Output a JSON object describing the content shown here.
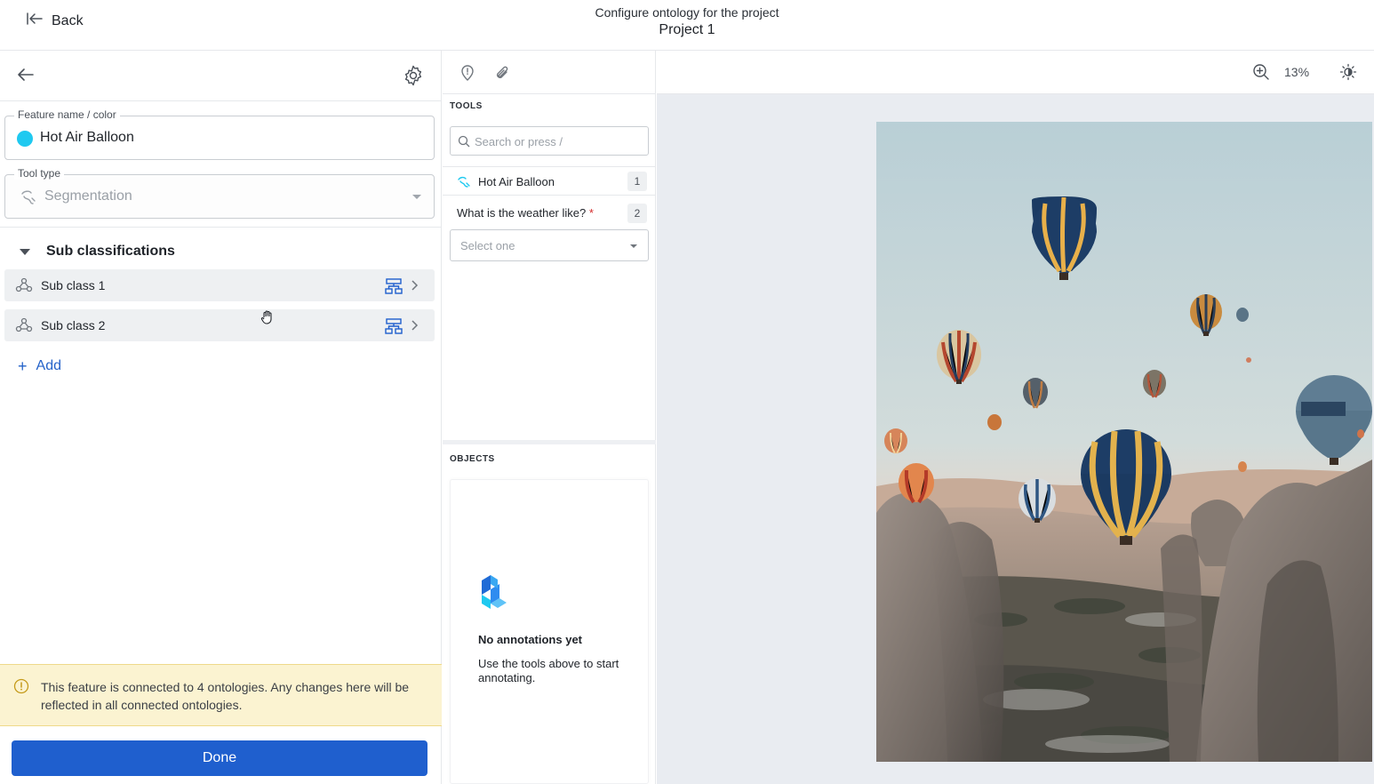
{
  "header": {
    "back_label": "Back",
    "subtitle": "Configure ontology for the project",
    "project_name": "Project 1"
  },
  "feature": {
    "name_label": "Feature name / color",
    "name_value": "Hot Air Balloon",
    "color": "#1fc9f0",
    "tool_type_label": "Tool type",
    "tool_type_value": "Segmentation"
  },
  "sub_classifications": {
    "title": "Sub classifications",
    "items": [
      {
        "label": "Sub class 1"
      },
      {
        "label": "Sub class 2"
      }
    ],
    "add_label": "Add"
  },
  "warning": {
    "text": "This feature is connected to 4 ontologies. Any changes here will be reflected in all connected ontologies."
  },
  "done_label": "Done",
  "tools": {
    "section_label": "TOOLS",
    "search_placeholder": "Search or press /",
    "items": [
      {
        "label": "Hot Air Balloon",
        "shortcut": "1"
      }
    ],
    "question": {
      "label": "What is the weather like?",
      "required_mark": "*",
      "shortcut": "2",
      "select_placeholder": "Select one"
    }
  },
  "objects": {
    "section_label": "OBJECTS",
    "empty_title": "No annotations yet",
    "empty_text": "Use the tools above to start annotating."
  },
  "viewer": {
    "zoom_level": "13%"
  },
  "colors": {
    "accent": "#1f5fce",
    "link": "#2563c9",
    "warning_bg": "#fbf3d1",
    "feature_color": "#1fc9f0"
  },
  "icons": [
    "back-arrow-icon",
    "arrow-left-icon",
    "gear-icon",
    "segmentation-icon",
    "chevron-down-icon",
    "sub-class-icon",
    "tree-icon",
    "chevron-right-icon",
    "plus-icon",
    "warning-icon",
    "pin-icon",
    "paperclip-icon",
    "search-icon",
    "zoom-in-icon",
    "brightness-icon",
    "app-logo-icon",
    "hand-cursor-icon"
  ]
}
